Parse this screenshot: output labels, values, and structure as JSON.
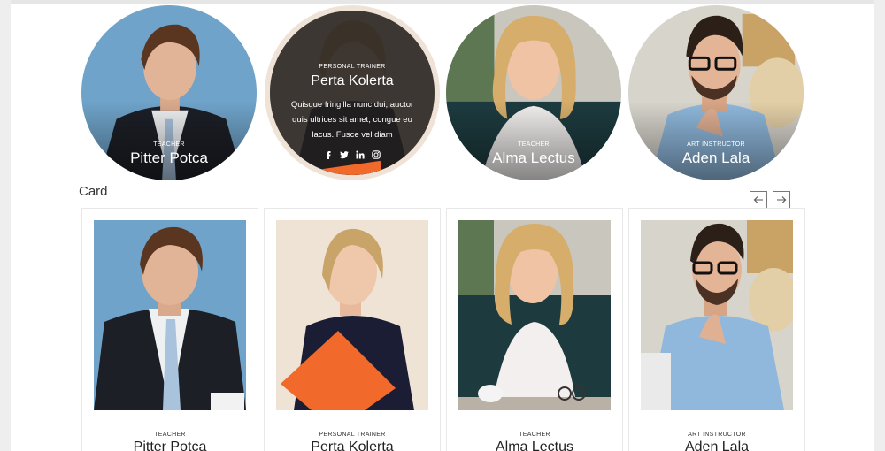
{
  "colors": {
    "accent": "#f26a2b",
    "overlay": "#221e1d",
    "ring": "#efe2d6",
    "card_border": "#e8e8e8"
  },
  "team_circles": [
    {
      "role": "TEACHER",
      "name": "Pitter Potca"
    },
    {
      "role": "PERSONAL TRAINER",
      "name": "Perta Kolerta",
      "description": "Quisque fringilla nunc dui, auctor quis ultrices sit amet, congue eu lacus. Fusce vel diam",
      "social": [
        "facebook-icon",
        "twitter-icon",
        "linkedin-icon",
        "instagram-icon"
      ]
    },
    {
      "role": "TEACHER",
      "name": "Alma Lectus"
    },
    {
      "role": "ART INSTRUCTOR",
      "name": "Aden Lala"
    }
  ],
  "section": {
    "title": "Card"
  },
  "nav": {
    "prev": "arrow-left-icon",
    "next": "arrow-right-icon"
  },
  "cards": [
    {
      "role": "TEACHER",
      "name": "Pitter Potca"
    },
    {
      "role": "PERSONAL TRAINER",
      "name": "Perta Kolerta"
    },
    {
      "role": "TEACHER",
      "name": "Alma Lectus"
    },
    {
      "role": "ART INSTRUCTOR",
      "name": "Aden Lala"
    }
  ]
}
